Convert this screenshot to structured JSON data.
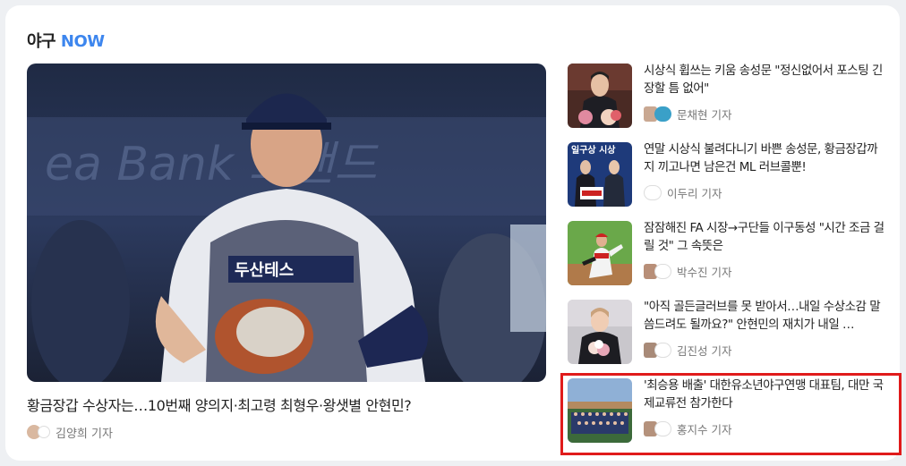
{
  "section": {
    "title_prefix": "야구",
    "title_accent": "NOW",
    "accent_color": "#3d86ee"
  },
  "main": {
    "headline": "황금장갑 수상자는…10번째 양의지·최고령 최형우·왕샛별 안현민?",
    "byline": "김양희 기자"
  },
  "side": [
    {
      "title": "시상식 휩쓰는 키움 송성문 \"정신없어서 포스팅 긴장할 틈 없어\"",
      "byline": "문채현 기자"
    },
    {
      "title": "연말 시상식 불려다니기 바쁜 송성문, 황금장갑까지 끼고나면 남은건 ML 러브콜뿐!",
      "byline": "이두리 기자"
    },
    {
      "title": "잠잠해진 FA 시장→구단들 이구동성 \"시간 조금 걸릴 것\" 그 속뜻은",
      "byline": "박수진 기자"
    },
    {
      "title": "\"아직 골든글러브를 못 받아서…내일 수상소감 말씀드려도 될까요?\" 안현민의 재치가 내일 …",
      "byline": "김진성 기자"
    },
    {
      "title": "'최승용 배출' 대한유소년야구연맹 대표팀, 대만 국제교류전 참가한다",
      "byline": "홍지수 기자"
    }
  ],
  "highlight_color": "#e01b1b"
}
